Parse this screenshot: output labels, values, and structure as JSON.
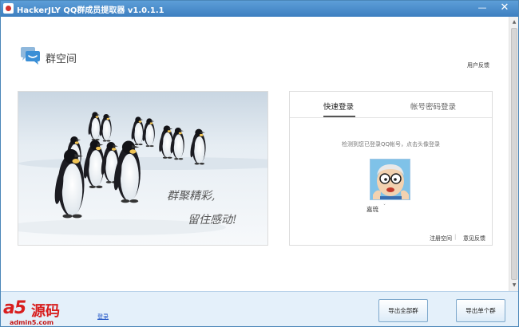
{
  "window": {
    "title": "HackerJLY QQ群成员提取器 v1.0.1.1",
    "minimize_glyph": "—",
    "close_glyph": "✕"
  },
  "header": {
    "logo_icon": "chat-bubble-icon",
    "logo_text": "群空间",
    "feedback_link": "用户反馈"
  },
  "banner": {
    "line1": "群聚精彩,",
    "line2": "留住感动!"
  },
  "login": {
    "tabs": [
      {
        "label": "快速登录",
        "active": true
      },
      {
        "label": "帐号密码登录",
        "active": false
      }
    ],
    "hint": "检测到您已登录QQ帐号，点击头像登录",
    "user_name": "嘉琉",
    "user_chevron": "ˇ",
    "register_link": "注册空间",
    "separator": "|",
    "feedback_link": "意见反馈"
  },
  "footer": {
    "watermark_brand": "a5",
    "watermark_cn": "源码",
    "watermark_url": "admin5.com",
    "login_link": "登录",
    "export_all_button": "导出全部群",
    "export_one_button": "导出单个群"
  },
  "colors": {
    "titlebar": "#3d7fc0",
    "footer_bg": "#e4f0fa",
    "link": "#1a4fc4",
    "watermark": "#d81e1e"
  }
}
